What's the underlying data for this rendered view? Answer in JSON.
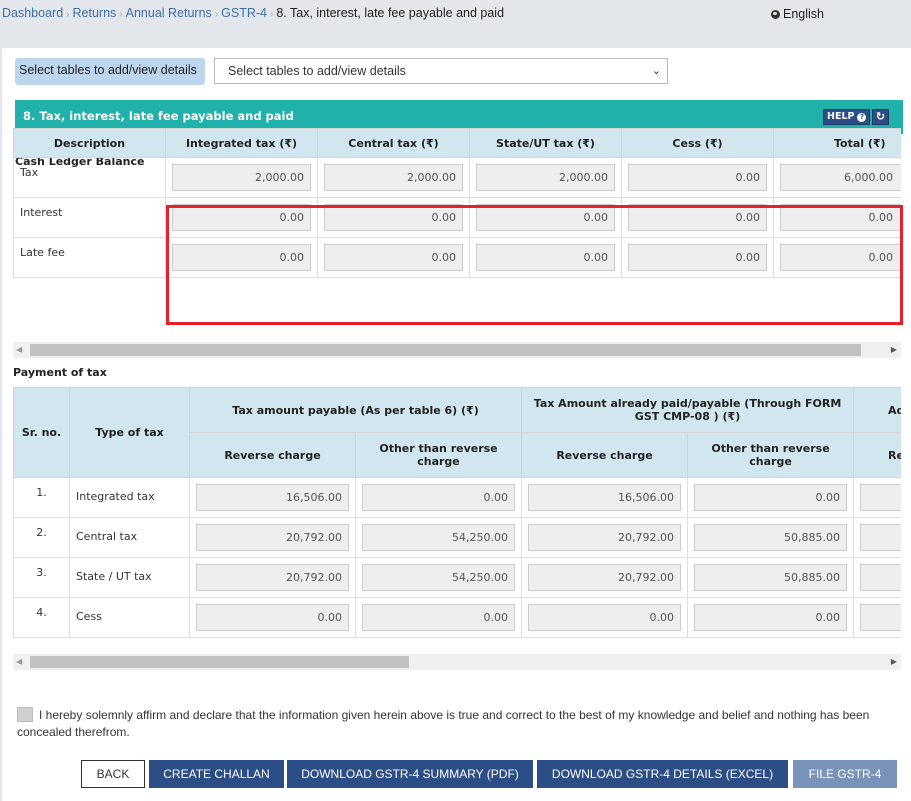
{
  "breadcrumb": {
    "items": [
      "Dashboard",
      "Returns",
      "Annual Returns",
      "GSTR-4"
    ],
    "current": "8. Tax, interest, late fee payable and paid"
  },
  "language": {
    "label": "English",
    "icon": "globe-icon"
  },
  "table_selector": {
    "label": "Select tables to add/view details",
    "selected": "Select tables to add/view details"
  },
  "section": {
    "title": "8. Tax, interest, late fee payable and paid",
    "help_label": "HELP",
    "help_icon": "question-circle-icon",
    "refresh_icon": "refresh-icon",
    "accent_color": "#20b2aa"
  },
  "cash_ledger": {
    "heading": "Cash Ledger Balance",
    "columns": [
      "Description",
      "Integrated tax (₹)",
      "Central tax (₹)",
      "State/UT tax (₹)",
      "Cess (₹)",
      "Total (₹)"
    ],
    "rows": [
      {
        "description": "Tax",
        "values": [
          "2,000.00",
          "2,000.00",
          "2,000.00",
          "0.00",
          "6,000.00"
        ]
      },
      {
        "description": "Interest",
        "values": [
          "0.00",
          "0.00",
          "0.00",
          "0.00",
          "0.00"
        ]
      },
      {
        "description": "Late fee",
        "values": [
          "0.00",
          "0.00",
          "0.00",
          "0.00",
          "0.00"
        ]
      }
    ],
    "highlight_color": "#e8202a"
  },
  "payment": {
    "heading": "Payment of tax",
    "header_row1": {
      "sr_no": "Sr. no.",
      "type": "Type of tax",
      "group1": "Tax amount payable (As per table 6) (₹)",
      "group2": "Tax Amount already paid/payable (Through FORM GST CMP-08 ) (₹)",
      "group3": "Ad"
    },
    "header_row2": [
      "Reverse charge",
      "Other than reverse charge",
      "Reverse charge",
      "Other than reverse charge",
      "Re"
    ],
    "rows": [
      {
        "sr": "1.",
        "type": "Integrated tax",
        "values": [
          "16,506.00",
          "0.00",
          "16,506.00",
          "0.00",
          ""
        ]
      },
      {
        "sr": "2.",
        "type": "Central tax",
        "values": [
          "20,792.00",
          "54,250.00",
          "20,792.00",
          "50,885.00",
          ""
        ]
      },
      {
        "sr": "3.",
        "type": "State / UT tax",
        "values": [
          "20,792.00",
          "54,250.00",
          "20,792.00",
          "50,885.00",
          ""
        ]
      },
      {
        "sr": "4.",
        "type": "Cess",
        "values": [
          "0.00",
          "0.00",
          "0.00",
          "0.00",
          ""
        ]
      }
    ]
  },
  "declaration": {
    "checked": false,
    "text": "I hereby solemnly affirm and declare that the information given herein above is true and correct to the best of my knowledge and belief and nothing has been concealed therefrom."
  },
  "buttons": {
    "back": "BACK",
    "create_challan": "CREATE CHALLAN",
    "download_summary": "DOWNLOAD GSTR-4 SUMMARY (PDF)",
    "download_details": "DOWNLOAD GSTR-4 DETAILS (EXCEL)",
    "file": "FILE GSTR-4"
  }
}
